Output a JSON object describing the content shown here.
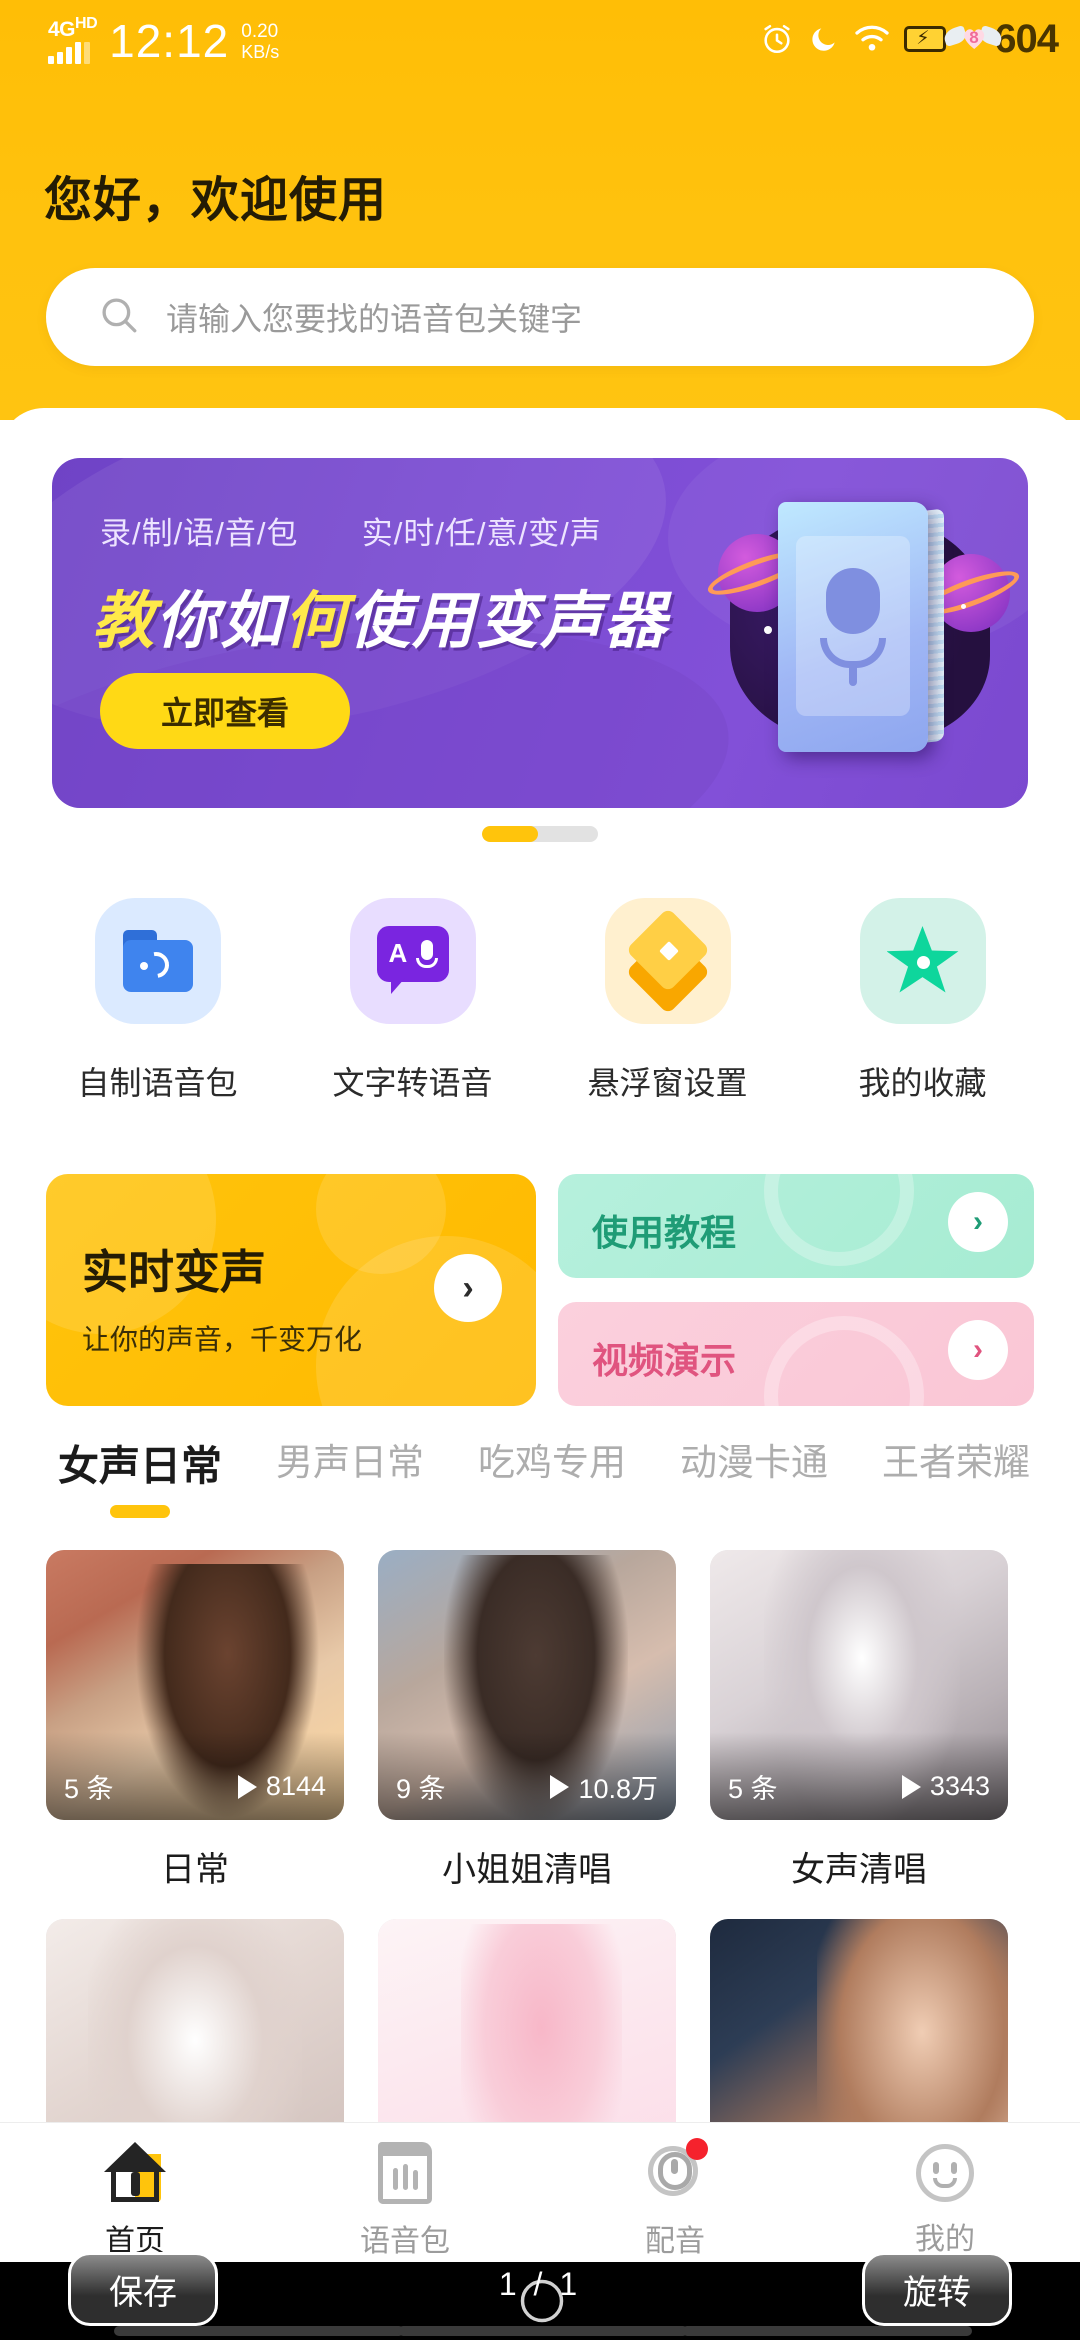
{
  "status_bar": {
    "network_type": "4G",
    "network_sup": "HD",
    "time": "12:12",
    "net_speed_value": "0.20",
    "net_speed_unit": "KB/s",
    "battery_clock": "604",
    "icons": [
      "alarm-icon",
      "moon-icon",
      "wifi-icon",
      "battery-charging-icon",
      "heart-sticker-icon"
    ]
  },
  "header": {
    "greeting": "您好，欢迎使用",
    "search_placeholder": "请输入您要找的语音包关键字",
    "accent_color": "#ffc20e"
  },
  "banner": {
    "tagline_left": "录/制/语/音/包",
    "tagline_right": "实/时/任/意/变/声",
    "title_part1": "教",
    "title_part2": "你如",
    "title_part3": "何",
    "title_part4": "使用",
    "title_part5": "变声器",
    "title_full": "教你如何使用变声器",
    "cta_label": "立即查看",
    "bg_color": "#7a4bd2",
    "cta_color": "#ffd915"
  },
  "carousel": {
    "current": 1,
    "total": 2
  },
  "quick_actions": [
    {
      "label": "自制语音包",
      "icon": "folder-sound-icon",
      "bubble": "b-blue"
    },
    {
      "label": "文字转语音",
      "icon": "text-to-speech-icon",
      "bubble": "b-purple"
    },
    {
      "label": "悬浮窗设置",
      "icon": "layers-icon",
      "bubble": "b-amber"
    },
    {
      "label": "我的收藏",
      "icon": "star-icon",
      "bubble": "b-teal"
    }
  ],
  "promos": {
    "big": {
      "title": "实时变声",
      "subtitle": "让你的声音，千变万化",
      "color": "#ffc40c"
    },
    "small": [
      {
        "title": "使用教程",
        "color": "#b6f0dd"
      },
      {
        "title": "视频演示",
        "color": "#fbd0dd"
      }
    ]
  },
  "category_tabs": [
    {
      "label": "女声日常",
      "active": true
    },
    {
      "label": "男声日常",
      "active": false
    },
    {
      "label": "吃鸡专用",
      "active": false
    },
    {
      "label": "动漫卡通",
      "active": false
    },
    {
      "label": "王者荣耀",
      "active": false
    }
  ],
  "voice_packs": [
    {
      "name": "日常",
      "count": "5 条",
      "plays": "8144",
      "art": "art1"
    },
    {
      "name": "小姐姐清唱",
      "count": "9 条",
      "plays": "10.8万",
      "art": "art2"
    },
    {
      "name": "女声清唱",
      "count": "5 条",
      "plays": "3343",
      "art": "art3"
    },
    {
      "name": "",
      "count": "",
      "plays": "",
      "art": "art4"
    },
    {
      "name": "",
      "count": "",
      "plays": "",
      "art": "art5"
    },
    {
      "name": "",
      "count": "",
      "plays": "",
      "art": "art6"
    }
  ],
  "bottom_nav": [
    {
      "label": "首页",
      "icon": "home-icon",
      "active": true,
      "badge": false
    },
    {
      "label": "语音包",
      "icon": "package-icon",
      "active": false,
      "badge": false
    },
    {
      "label": "配音",
      "icon": "dubbing-icon",
      "active": false,
      "badge": true
    },
    {
      "label": "我的",
      "icon": "profile-icon",
      "active": false,
      "badge": false
    }
  ],
  "overlay": {
    "save_label": "保存",
    "rotate_label": "旋转",
    "page_indicator": "1 / 1"
  }
}
